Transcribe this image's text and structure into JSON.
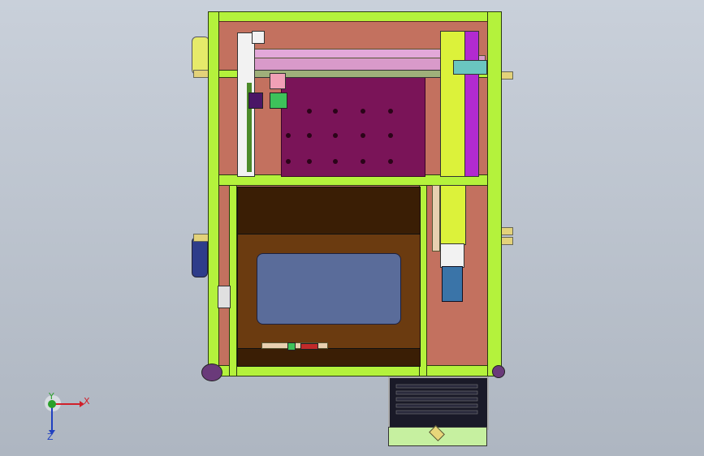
{
  "viewport": {
    "background_top": "#c9d0da",
    "background_bottom": "#aeb6c1"
  },
  "model": {
    "frame_color": "#b4f23c",
    "base_color": "#c3715f",
    "plate_color": "#7a1458",
    "cavity_color": "#3a1e05",
    "tray_color": "#6b3b10",
    "window_color": "#5a6c9a",
    "bracket_color": "#e3d27a",
    "motor_color": "#3a74a8",
    "actuator_color": "#b22ad0"
  },
  "triad": {
    "x_label": "X",
    "y_label": "Y",
    "z_label": "Z",
    "x_color": "#d0202a",
    "y_color": "#2aa02a",
    "z_color": "#2040c0"
  }
}
